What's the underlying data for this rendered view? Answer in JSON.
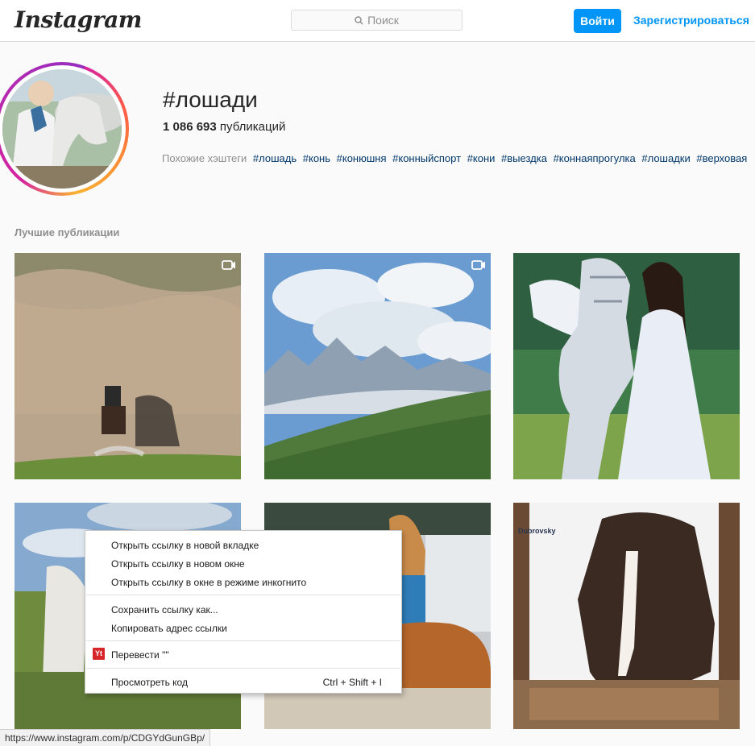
{
  "header": {
    "logo": "Instagram",
    "search_placeholder": "Поиск",
    "login_label": "Войти",
    "signup_label": "Зарегистрироваться"
  },
  "profile": {
    "hashtag": "#лошади",
    "posts_count": "1 086 693",
    "posts_label": "публикаций",
    "related_label": "Похожие хэштеги",
    "related_tags": [
      "#лошадь",
      "#конь",
      "#конюшня",
      "#конныйспорт",
      "#кони",
      "#выездка",
      "#коннаяпрогулка",
      "#лошадки",
      "#верховая"
    ]
  },
  "section": {
    "top_posts_label": "Лучшие публикации"
  },
  "posts": [
    {
      "id": "post-1",
      "type": "video"
    },
    {
      "id": "post-2",
      "type": "video"
    },
    {
      "id": "post-3",
      "type": "image"
    },
    {
      "id": "post-4",
      "type": "image"
    },
    {
      "id": "post-5",
      "type": "image"
    },
    {
      "id": "post-6",
      "type": "image",
      "overlay_text": "Dubrovsky"
    }
  ],
  "context_menu": {
    "open_new_tab": "Открыть ссылку в новой вкладке",
    "open_new_window": "Открыть ссылку в новом окне",
    "open_incognito": "Открыть ссылку в окне в режиме инкогнито",
    "save_link_as": "Сохранить ссылку как...",
    "copy_link": "Копировать адрес ссылки",
    "translate": "Перевести \"\"",
    "translate_badge": "Yt",
    "inspect": "Просмотреть код",
    "inspect_shortcut": "Ctrl + Shift + I"
  },
  "status_bar": {
    "url": "https://www.instagram.com/p/CDGYdGunGBp/"
  },
  "colors": {
    "accent": "#0095f6",
    "link_tag": "#00376b",
    "muted": "#8e8e8e",
    "translate_red": "#d6262b"
  }
}
